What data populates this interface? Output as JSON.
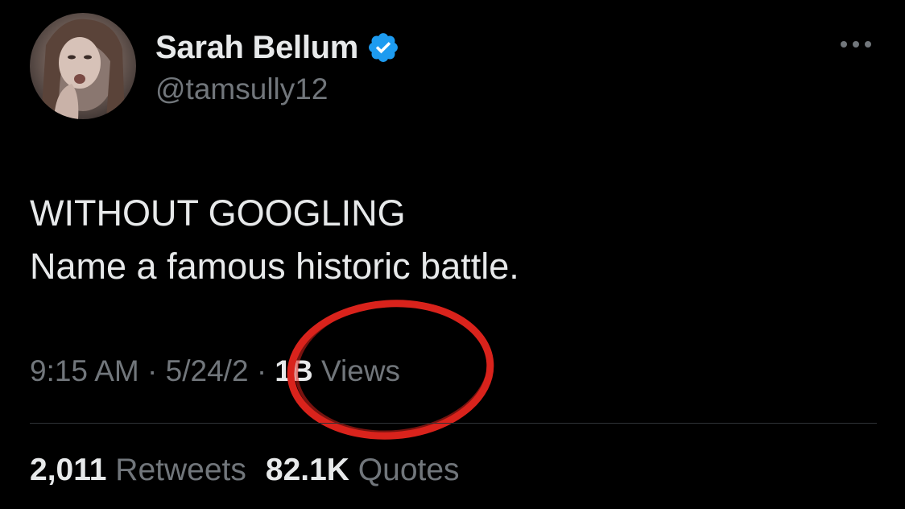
{
  "author": {
    "display_name": "Sarah Bellum",
    "handle": "@tamsully12",
    "verified": true,
    "verified_color": "#1d9bf0"
  },
  "tweet": {
    "lines": [
      "WITHOUT GOOGLING",
      "Name a famous historic battle."
    ]
  },
  "meta": {
    "time": "9:15 AM",
    "separator": "·",
    "date": "5/24/2",
    "views_count": "1B",
    "views_label": "Views"
  },
  "stats": {
    "retweets_count": "2,011",
    "retweets_label": "Retweets",
    "quotes_count": "82.1K",
    "quotes_label": "Quotes"
  },
  "annotation": {
    "color": "#d9231c"
  },
  "icons": {
    "more": "more-horizontal-icon",
    "verified": "verified-badge-icon"
  }
}
